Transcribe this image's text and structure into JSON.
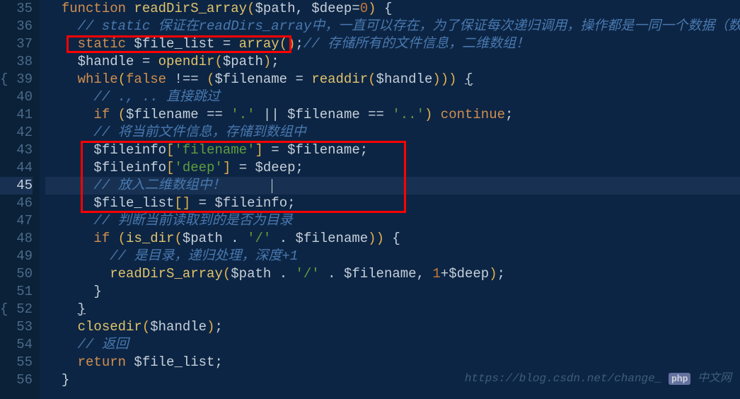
{
  "lines": {
    "35": {
      "num": "35"
    },
    "36": {
      "num": "36"
    },
    "37": {
      "num": "37"
    },
    "38": {
      "num": "38"
    },
    "39": {
      "num": "39",
      "brace": "{"
    },
    "40": {
      "num": "40"
    },
    "41": {
      "num": "41"
    },
    "42": {
      "num": "42"
    },
    "43": {
      "num": "43"
    },
    "44": {
      "num": "44"
    },
    "45": {
      "num": "45"
    },
    "46": {
      "num": "46"
    },
    "47": {
      "num": "47"
    },
    "48": {
      "num": "48"
    },
    "49": {
      "num": "49"
    },
    "50": {
      "num": "50"
    },
    "51": {
      "num": "51"
    },
    "52": {
      "num": "52",
      "brace": "{"
    },
    "53": {
      "num": "53"
    },
    "54": {
      "num": "54"
    },
    "55": {
      "num": "55"
    },
    "56": {
      "num": "56"
    }
  },
  "code": {
    "l35": {
      "kw_function": "function",
      "fn_name": " readDirS_array",
      "paren_open": "(",
      "var_path": "$path",
      "comma": ", ",
      "var_deep": "$deep",
      "eq": "=",
      "num_0": "0",
      "paren_close": ") ",
      "brace_open": "{"
    },
    "l36": {
      "comment": "// static 保证在readDirs_array中，一直可以存在，为了保证每次递归调用，操作都是一同一个数据（数组）"
    },
    "l37": {
      "kw_static": "static",
      "var_filelist": " $file_list ",
      "eq": "= ",
      "fn_array": "array",
      "parens": "()",
      "semi": ";",
      "comment": "// 存储所有的文件信息，二维数组！"
    },
    "l38": {
      "var_handle": "$handle ",
      "eq": "= ",
      "fn_opendir": "opendir",
      "paren_open": "(",
      "var_path": "$path",
      "paren_close": ")",
      "semi": ";"
    },
    "l39": {
      "kw_while": "while",
      "paren_open": "(",
      "kw_false": "false",
      "neq": " !== ",
      "paren_open2": "(",
      "var_filename": "$filename ",
      "eq": "= ",
      "fn_readdir": "readdir",
      "paren_open3": "(",
      "var_handle": "$handle",
      "paren_close3": ")))",
      "space": " ",
      "brace_open": "{"
    },
    "l40": {
      "comment": "// ., .. 直接跳过"
    },
    "l41": {
      "kw_if": "if ",
      "paren_open": "(",
      "var_filename": "$filename ",
      "eqeq": "== ",
      "str_dot": "'.'",
      "or": " || ",
      "var_filename2": "$filename ",
      "eqeq2": "== ",
      "str_dotdot": "'..'",
      "paren_close": ") ",
      "kw_continue": "continue",
      "semi": ";"
    },
    "l42": {
      "comment": "// 将当前文件信息，存储到数组中"
    },
    "l43": {
      "var_fileinfo": "$fileinfo",
      "bracket_open": "[",
      "str_filename": "'filename'",
      "bracket_close": "] ",
      "eq": "= ",
      "var_filename": "$filename",
      "semi": ";"
    },
    "l44": {
      "var_fileinfo": "$fileinfo",
      "bracket_open": "[",
      "str_deep": "'deep'",
      "bracket_close": "] ",
      "eq": "= ",
      "var_deep": "$deep",
      "semi": ";"
    },
    "l45": {
      "comment": "// 放入二维数组中！"
    },
    "l46": {
      "var_filelist": "$file_list",
      "brackets": "[] ",
      "eq": "= ",
      "var_fileinfo": "$fileinfo",
      "semi": ";"
    },
    "l47": {
      "comment": "// 判断当前读取到的是否为目录"
    },
    "l48": {
      "kw_if": "if ",
      "paren_open": "(",
      "fn_isdir": "is_dir",
      "paren_open2": "(",
      "var_path": "$path ",
      "dot": ". ",
      "str_slash": "'/'",
      "dot2": " . ",
      "var_filename": "$filename",
      "paren_close": ")) ",
      "brace_open": "{"
    },
    "l49": {
      "comment": "// 是目录，递归处理，深度+1"
    },
    "l50": {
      "fn_name": "readDirS_array",
      "paren_open": "(",
      "var_path": "$path ",
      "dot": ". ",
      "str_slash": "'/'",
      "dot2": " . ",
      "var_filename": "$filename",
      "comma": ", ",
      "num_1": "1",
      "plus": "+",
      "var_deep": "$deep",
      "paren_close": ")",
      "semi": ";"
    },
    "l51": {
      "brace_close": "}"
    },
    "l52": {
      "brace_close": "}"
    },
    "l53": {
      "fn_closedir": "closedir",
      "paren_open": "(",
      "var_handle": "$handle",
      "paren_close": ")",
      "semi": ";"
    },
    "l54": {
      "comment": "// 返回"
    },
    "l55": {
      "kw_return": "return",
      "var_filelist": " $file_list",
      "semi": ";"
    },
    "l56": {
      "brace_close": "}"
    }
  },
  "watermark": {
    "text": "https://blog.csdn.net/change_",
    "logo": "php",
    "tail": "中文网"
  }
}
